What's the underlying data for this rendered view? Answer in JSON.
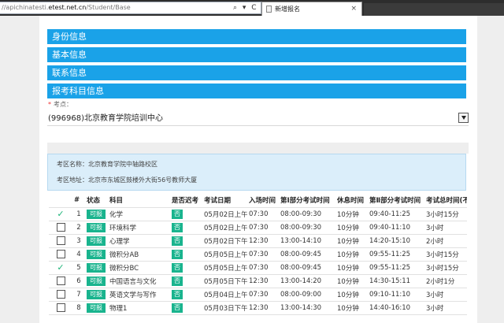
{
  "browser": {
    "url_prefix": "//apichinatesti.",
    "url_domain": "etest.net.cn",
    "url_path": "/Student/Base",
    "url_controls": "⌕ ▾ C",
    "tab_title": "新增报名",
    "tab_close": "×"
  },
  "sections": [
    "身份信息",
    "基本信息",
    "联系信息",
    "报考科目信息"
  ],
  "test_site": {
    "label": "考点：",
    "value": "(996968)北京教育学院培训中心"
  },
  "site_info": {
    "name_line": "考区名称：北京教育学院中轴路校区",
    "address_line": "考区地址：北京市东城区鼓楼外大街56号教师大厦"
  },
  "table": {
    "headers": [
      "#",
      "状态",
      "科目",
      "是否迟考",
      "考试日期",
      "入场时间",
      "第Ⅰ部分考试时间",
      "休息时间",
      "第Ⅱ部分考试时间",
      "考试总时间(不"
    ],
    "rows": [
      {
        "selected": true,
        "num": "1",
        "status": "可报",
        "subject": "化学",
        "late": "否",
        "date": "05月02日上午",
        "entry": "07:30",
        "part1": "08:00-09:30",
        "rest": "10分钟",
        "part2": "09:40-11:25",
        "total": "3小时15分"
      },
      {
        "selected": false,
        "num": "2",
        "status": "可报",
        "subject": "环境科学",
        "late": "否",
        "date": "05月02日上午",
        "entry": "07:30",
        "part1": "08:00-09:30",
        "rest": "10分钟",
        "part2": "09:40-11:10",
        "total": "3小时"
      },
      {
        "selected": false,
        "num": "3",
        "status": "可报",
        "subject": "心理学",
        "late": "否",
        "date": "05月02日下午",
        "entry": "12:30",
        "part1": "13:00-14:10",
        "rest": "10分钟",
        "part2": "14:20-15:10",
        "total": "2小时"
      },
      {
        "selected": false,
        "num": "4",
        "status": "可报",
        "subject": "微积分AB",
        "late": "否",
        "date": "05月05日上午",
        "entry": "07:30",
        "part1": "08:00-09:45",
        "rest": "10分钟",
        "part2": "09:55-11:25",
        "total": "3小时15分"
      },
      {
        "selected": true,
        "num": "5",
        "status": "可报",
        "subject": "微积分BC",
        "late": "否",
        "date": "05月05日上午",
        "entry": "07:30",
        "part1": "08:00-09:45",
        "rest": "10分钟",
        "part2": "09:55-11:25",
        "total": "3小时15分"
      },
      {
        "selected": false,
        "num": "6",
        "status": "可报",
        "subject": "中国语言与文化",
        "late": "否",
        "date": "05月05日下午",
        "entry": "12:30",
        "part1": "13:00-14:20",
        "rest": "10分钟",
        "part2": "14:30-15:11",
        "total": "2小时1分"
      },
      {
        "selected": false,
        "num": "7",
        "status": "可报",
        "subject": "英语文学与写作",
        "late": "否",
        "date": "05月04日上午",
        "entry": "07:30",
        "part1": "08:00-09:00",
        "rest": "10分钟",
        "part2": "09:10-11:10",
        "total": "3小时"
      },
      {
        "selected": false,
        "num": "8",
        "status": "可报",
        "subject": "物理1",
        "late": "否",
        "date": "05月03日下午",
        "entry": "12:30",
        "part1": "13:00-14:30",
        "rest": "10分钟",
        "part2": "14:40-16:10",
        "total": "3小时"
      }
    ]
  },
  "colors": {
    "section_bar": "#1aa2e8",
    "badge": "#19b48e",
    "tick": "#1cb478",
    "info_bg": "#dbeefa"
  },
  "icons": {
    "selected": "check-icon",
    "unselected": "checkbox-icon"
  }
}
